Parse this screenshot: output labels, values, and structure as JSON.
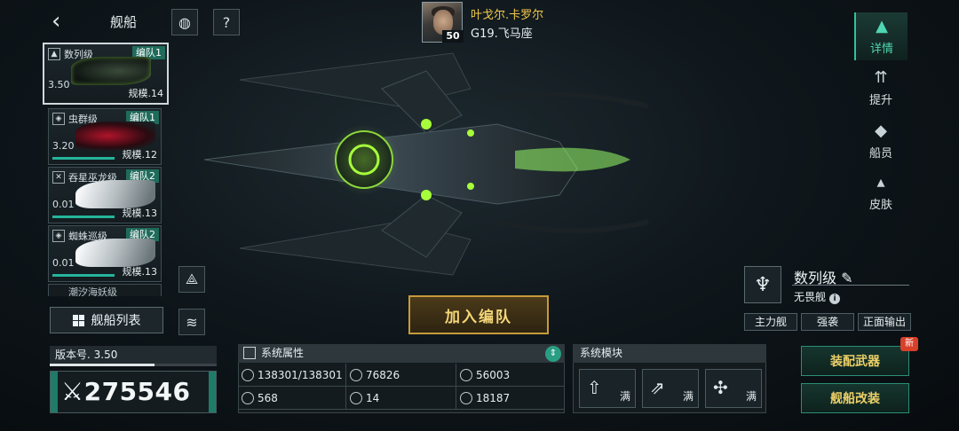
{
  "header": {
    "title": "舰船"
  },
  "commander": {
    "name": "叶戈尔.卡罗尔",
    "level": "50",
    "rank": "G19.飞马座"
  },
  "ship_list": [
    {
      "name": "数列级",
      "fleet": "编队1",
      "version": "3.50",
      "scale": "规模.14",
      "thumb": "dark"
    },
    {
      "name": "虫群级",
      "fleet": "编队1",
      "version": "3.20",
      "scale": "规模.12",
      "thumb": "red"
    },
    {
      "name": "吞星巫龙级",
      "fleet": "编队2",
      "version": "0.01",
      "scale": "规模.13",
      "thumb": "white"
    },
    {
      "name": "蜘蛛巡级",
      "fleet": "编队2",
      "version": "0.01",
      "scale": "规模.13",
      "thumb": "white"
    }
  ],
  "ship_list_partial": "潮汐海妖级",
  "ship_list_button": "舰船列表",
  "version": {
    "label": "版本号. 3.50",
    "progress": 0.63
  },
  "power": {
    "value": "275546"
  },
  "join_button": "加入编队",
  "system_attributes": {
    "title": "系统属性",
    "items": [
      "138301/138301",
      "76826",
      "56003",
      "568",
      "14",
      "18187"
    ]
  },
  "system_modules": {
    "title": "系统模块",
    "slots": [
      {
        "icon": "rocket-icon",
        "status": "满"
      },
      {
        "icon": "missiles-icon",
        "status": "满"
      },
      {
        "icon": "drones-icon",
        "status": "满"
      }
    ]
  },
  "right_nav": [
    "详情",
    "提升",
    "船员",
    "皮肤"
  ],
  "ship_class": {
    "name": "数列级",
    "subtitle": "无畏舰",
    "tags": [
      "主力舰",
      "强袭",
      "正面输出"
    ]
  },
  "actions": {
    "equip": "装配武器",
    "modify": "舰船改装",
    "badge": "新"
  },
  "colors": {
    "accent": "#2ec39f",
    "gold": "#f2c84a",
    "fleet_tag": "#1f6b5c",
    "button_border": "#c79a3a"
  }
}
